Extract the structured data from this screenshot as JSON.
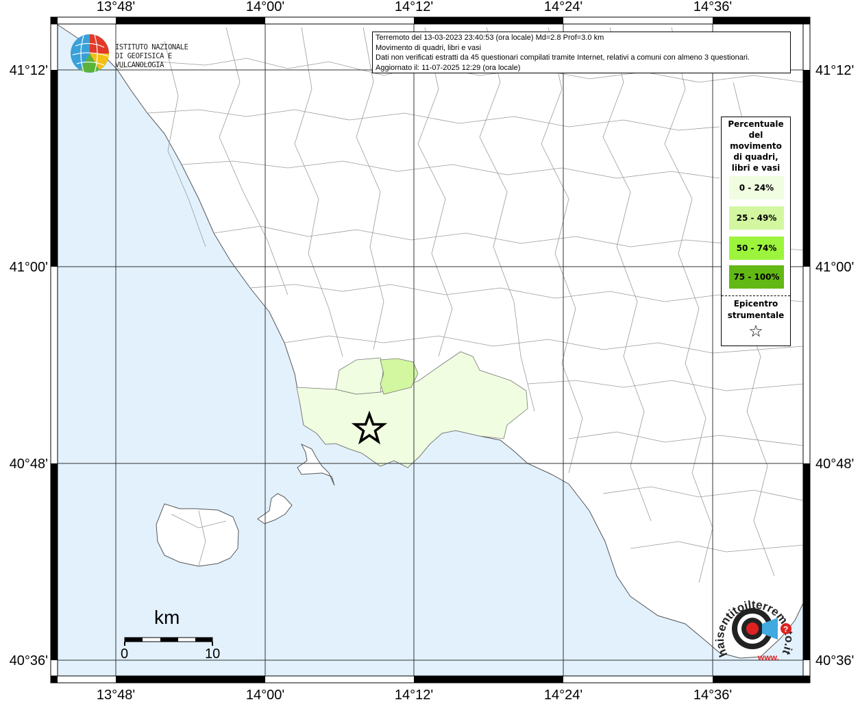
{
  "info": {
    "line1": "Terremoto del 13-03-2023 23:40:53 (ora locale) Md=2.8 Prof=3.0 km",
    "line2": "Movimento di quadri, libri e vasi",
    "line3": "Dati non verificati estratti da 45 questionari compilati tramite Internet, relativi a comuni con almeno 3 questionari.",
    "line4": "Aggiornato il: 11-07-2025 12:29 (ora locale)"
  },
  "ticks": {
    "lon": [
      "13°48'",
      "14°00'",
      "14°12'",
      "14°24'",
      "14°36'"
    ],
    "lat": [
      "41°12'",
      "41°00'",
      "40°48'",
      "40°36'"
    ]
  },
  "legend": {
    "title": "Percentuale del movimento di quadri, libri e vasi",
    "title_lines": [
      "Percentuale",
      "del",
      "movimento",
      "di quadri,",
      "libri e vasi"
    ],
    "classes": [
      {
        "label": "0 - 24%",
        "color": "#f0fde0"
      },
      {
        "label": "25 - 49%",
        "color": "#d2f7a0"
      },
      {
        "label": "50 - 74%",
        "color": "#9cf53c"
      },
      {
        "label": "75 - 100%",
        "color": "#62b814"
      }
    ],
    "epicenter_lines": [
      "Epicentro",
      "strumentale"
    ],
    "star": "☆"
  },
  "logo": {
    "line1": "ISTITUTO NAZIONALE",
    "line2": "DI GEOFISICA E VULCANOLOGIA"
  },
  "scale": {
    "unit": "km",
    "start": "0",
    "end": "10"
  },
  "colors": {
    "sea": "#e2f1fc",
    "land": "#ffffff",
    "class_low": "#f0fde0",
    "class_mid": "#d2f7a0"
  },
  "hst_logo": {
    "text": "haisentitoilterremoto.it",
    "www": "www."
  }
}
